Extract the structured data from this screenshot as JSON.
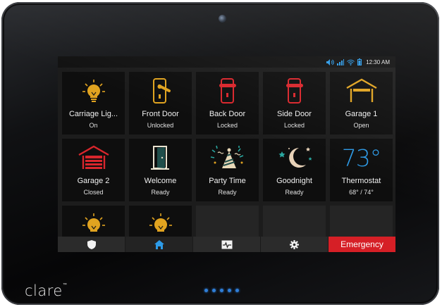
{
  "status": {
    "time": "12:30 AM"
  },
  "tiles": [
    {
      "name": "Carriage Lig...",
      "state": "On",
      "icon": "light-bulb-icon"
    },
    {
      "name": "Front Door",
      "state": "Unlocked",
      "icon": "door-lock-unlocked-icon"
    },
    {
      "name": "Back Door",
      "state": "Locked",
      "icon": "door-lock-locked-icon"
    },
    {
      "name": "Side Door",
      "state": "Locked",
      "icon": "door-lock-locked-icon"
    },
    {
      "name": "Garage 1",
      "state": "Open",
      "icon": "garage-open-icon"
    },
    {
      "name": "Garage 2",
      "state": "Closed",
      "icon": "garage-closed-icon"
    },
    {
      "name": "Welcome",
      "state": "Ready",
      "icon": "open-door-icon"
    },
    {
      "name": "Party Time",
      "state": "Ready",
      "icon": "party-hat-icon"
    },
    {
      "name": "Goodnight",
      "state": "Ready",
      "icon": "moon-stars-icon"
    },
    {
      "name": "Thermostat",
      "state": "68° / 74°",
      "temperature": "73°",
      "icon": "thermostat"
    },
    {
      "icon": "light-bulb-icon"
    },
    {
      "icon": "light-bulb-icon"
    }
  ],
  "navbar": {
    "items": [
      "shield-icon",
      "home-icon",
      "activity-icon",
      "gear-icon"
    ],
    "emergency_label": "Emergency"
  },
  "device": {
    "brand": "clare",
    "trademark": "™"
  },
  "colors": {
    "accent_blue": "#2d9be8",
    "light_gold": "#e0a320",
    "locked_red": "#d9262c",
    "emergency_red": "#d61f26"
  }
}
